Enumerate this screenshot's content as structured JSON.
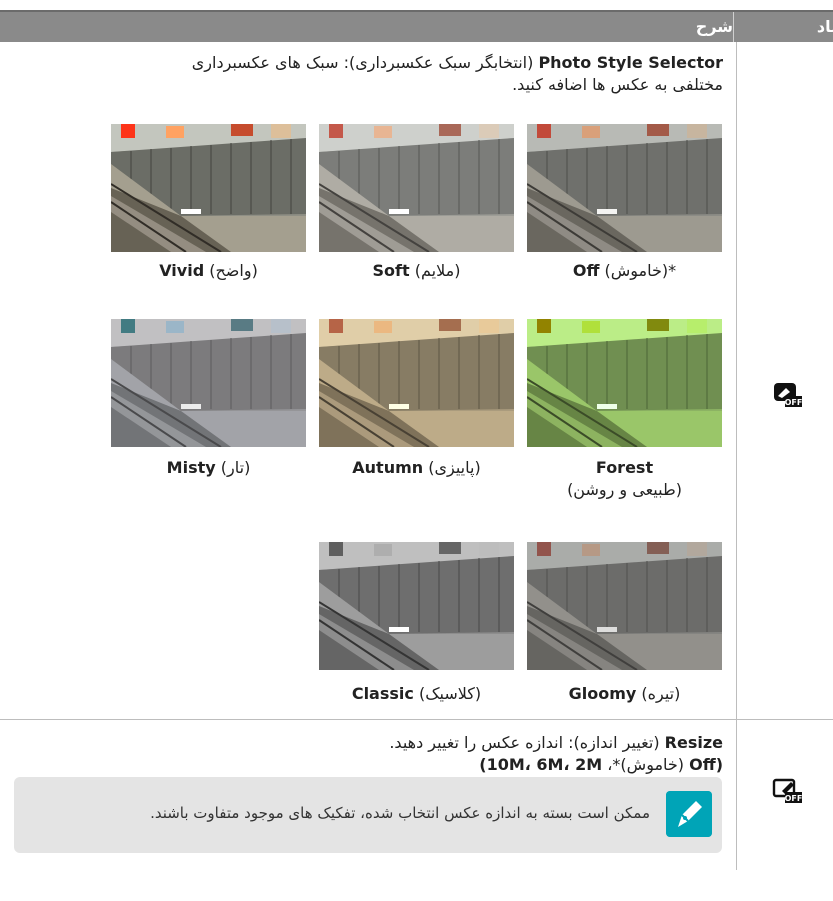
{
  "header": {
    "description": "شرح",
    "symbol": "ماد"
  },
  "photo_style": {
    "title": "Photo Style Selector",
    "title_suffix": " (انتخابگر سبک عکسبرداری): سبک های عکسبرداری",
    "line2": "مختلفی به عکس ها اضافه کنید.",
    "icon": "photo-style-off-icon",
    "styles": [
      {
        "name": "Off",
        "note": " (خاموش)*",
        "tint": "normal"
      },
      {
        "name": "Soft",
        "note": " (ملایم)",
        "tint": "soft"
      },
      {
        "name": "Vivid",
        "note": " (واضح)",
        "tint": "vivid"
      },
      {
        "name": "Forest",
        "note": "(طبیعی و روشن)",
        "tint": "green"
      },
      {
        "name": "Autumn",
        "note": " (پاییزی)",
        "tint": "warm"
      },
      {
        "name": "Misty",
        "note": " (تار)",
        "tint": "misty"
      },
      {
        "name": "Gloomy",
        "note": " (تیره)",
        "tint": "dark"
      },
      {
        "name": "Classic",
        "note": " (کلاسیک)",
        "tint": "mono"
      }
    ]
  },
  "resize": {
    "title": "Resize",
    "title_suffix": " (تغییر اندازه): اندازه عکس را تغییر دهید.",
    "options_bold": "(Off",
    "options_mid": " (خاموش)*، ",
    "options_rest": "10M، 6M، 2M)",
    "icon": "resize-off-icon"
  },
  "note": {
    "text": "ممکن است بسته به اندازه عکس انتخاب شده، تفکیک های موجود متفاوت باشند.",
    "icon": "pencil-note-icon"
  }
}
